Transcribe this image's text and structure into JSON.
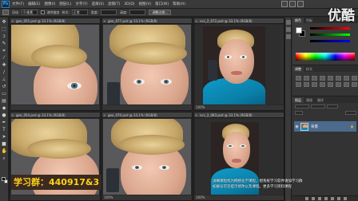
{
  "app": {
    "logo": "Ps",
    "menu": [
      "文件(F)",
      "编辑(E)",
      "图像(I)",
      "图层(L)",
      "文字(Y)",
      "选择(S)",
      "滤镜(T)",
      "3D(D)",
      "视图(V)",
      "窗口(W)",
      "帮助(H)"
    ]
  },
  "options": {
    "labels": [
      "羽化:",
      "0 像素",
      "消除锯齿",
      "样式:",
      "正常",
      "宽度:",
      "高度:",
      "调整边缘..."
    ]
  },
  "documents": [
    {
      "tab": "geo_055.psd @ 33.1% (RGB/8)",
      "status": ""
    },
    {
      "tab": "geo_077.psd @ 33.1% (RGB/8)",
      "status": ""
    },
    {
      "tab": "ncc_2_072.psd @ 33.1% (RGB/8)",
      "status": "100%"
    },
    {
      "tab": "geo_054.psd @ 33.1% (RGB/8)",
      "status": ""
    },
    {
      "tab": "geo_070.psd @ 33.1% (RGB/8)",
      "status": "100%"
    },
    {
      "tab": "ncc_2_083.psd @ 33.1% (RGB/8)",
      "status": "100%"
    }
  ],
  "panels": {
    "color_tabs": [
      "颜色",
      "色板"
    ],
    "adjust_tabs": [
      "调整",
      "样式"
    ],
    "layers_tabs": [
      "图层",
      "通道",
      "路径"
    ],
    "layer_name": "背景",
    "layer_lock": "🔒"
  },
  "overlay": {
    "brand": "优酷",
    "watermark": "学习群：440917&3",
    "subtitle_line1": "详细课程找为网络化学课程，想系统学习软件请加学习群",
    "subtitle_line2": "如群号可见提示修改以及课程。更多学习资料课程"
  },
  "colors": {
    "shirt": "#0a8ab9",
    "hair": "#d9bd82",
    "layer_selected": "#4b6a8c",
    "watermark_text": "#ffd21a"
  }
}
